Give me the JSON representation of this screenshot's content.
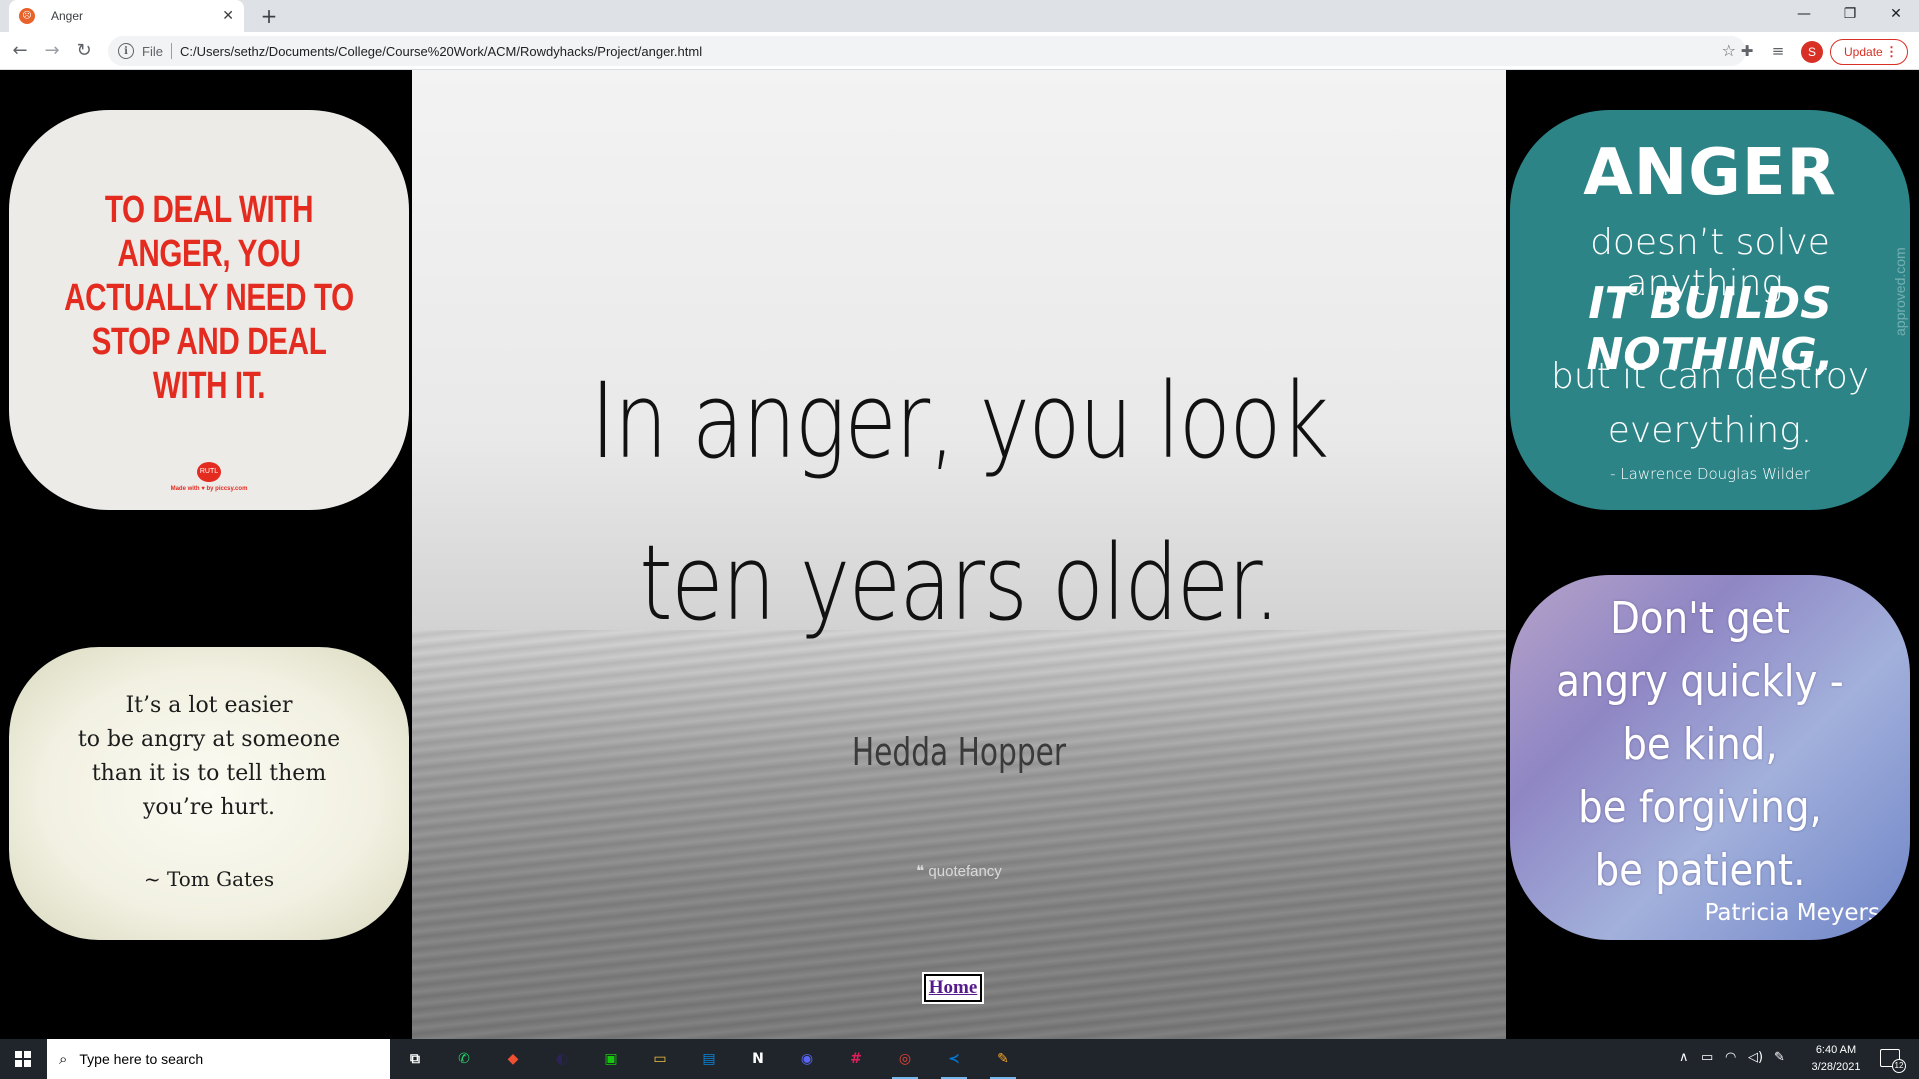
{
  "browser": {
    "tab": {
      "title": "Anger",
      "close": "✕"
    },
    "new_tab": "+",
    "window_controls": {
      "minimize": "—",
      "restore": "❐",
      "close": "✕"
    },
    "nav": {
      "back": "←",
      "forward": "→",
      "reload": "↻"
    },
    "omnibox": {
      "scheme": "File",
      "url": "C:/Users/sethz/Documents/College/Course%20Work/ACM/Rowdyhacks/Project/anger.html"
    },
    "profile_initial": "S",
    "update_label": "Update"
  },
  "page": {
    "center": {
      "quote_line1": "In anger, you look",
      "quote_line2": "ten years older.",
      "author": "Hedda Hopper",
      "watermark": "❝ quotefancy"
    },
    "home_link": "Home",
    "cards": {
      "top_left": {
        "lines": [
          "TO DEAL WITH",
          "ANGER, YOU",
          "ACTUALLY NEED TO",
          "STOP AND DEAL",
          "WITH IT."
        ],
        "logo": "RUTL",
        "made": "Made with ♥ by piccsy.com",
        "accent": "#e42b1f"
      },
      "bottom_left": {
        "lines": [
          "It’s a lot easier",
          "to be angry at someone",
          "than it is to tell them",
          "you’re hurt."
        ],
        "author": "~ Tom Gates"
      },
      "top_right": {
        "title": "ANGER",
        "line1": "doesn’t solve anything.",
        "line2": "IT BUILDS NOTHING,",
        "line3": "but it can destroy",
        "line4": "everything.",
        "author": "- Lawrence Douglas Wilder",
        "watermark": "approved.com",
        "bg": "#2d8487"
      },
      "bottom_right": {
        "lines": [
          "Don't get",
          "angry quickly -",
          "be kind,",
          "be forgiving,",
          "be patient."
        ],
        "author": "Patricia Meyers"
      }
    }
  },
  "taskbar": {
    "search_placeholder": "Type here to search",
    "clock_time": "6:40 AM",
    "clock_date": "3/28/2021",
    "notification_count": "12",
    "apps": [
      {
        "name": "task-view",
        "glyph": "⧉"
      },
      {
        "name": "whatsapp",
        "glyph": "✆",
        "color": "#25d366"
      },
      {
        "name": "git",
        "glyph": "◆",
        "color": "#f05032"
      },
      {
        "name": "eclipse",
        "glyph": "◐",
        "color": "#2c2255"
      },
      {
        "name": "terminal",
        "glyph": "▣",
        "color": "#16c60c"
      },
      {
        "name": "file-explorer",
        "glyph": "▭",
        "color": "#f3c13a"
      },
      {
        "name": "store",
        "glyph": "▤",
        "color": "#0a84d8"
      },
      {
        "name": "notion",
        "glyph": "N",
        "color": "#ffffff"
      },
      {
        "name": "discord",
        "glyph": "◉",
        "color": "#5865f2"
      },
      {
        "name": "slack",
        "glyph": "#",
        "color": "#e01e5a"
      },
      {
        "name": "chrome",
        "glyph": "◎",
        "color": "#ea4335"
      },
      {
        "name": "vscode",
        "glyph": "≺",
        "color": "#0078d4"
      },
      {
        "name": "paint",
        "glyph": "✎",
        "color": "#f9a825"
      }
    ]
  }
}
